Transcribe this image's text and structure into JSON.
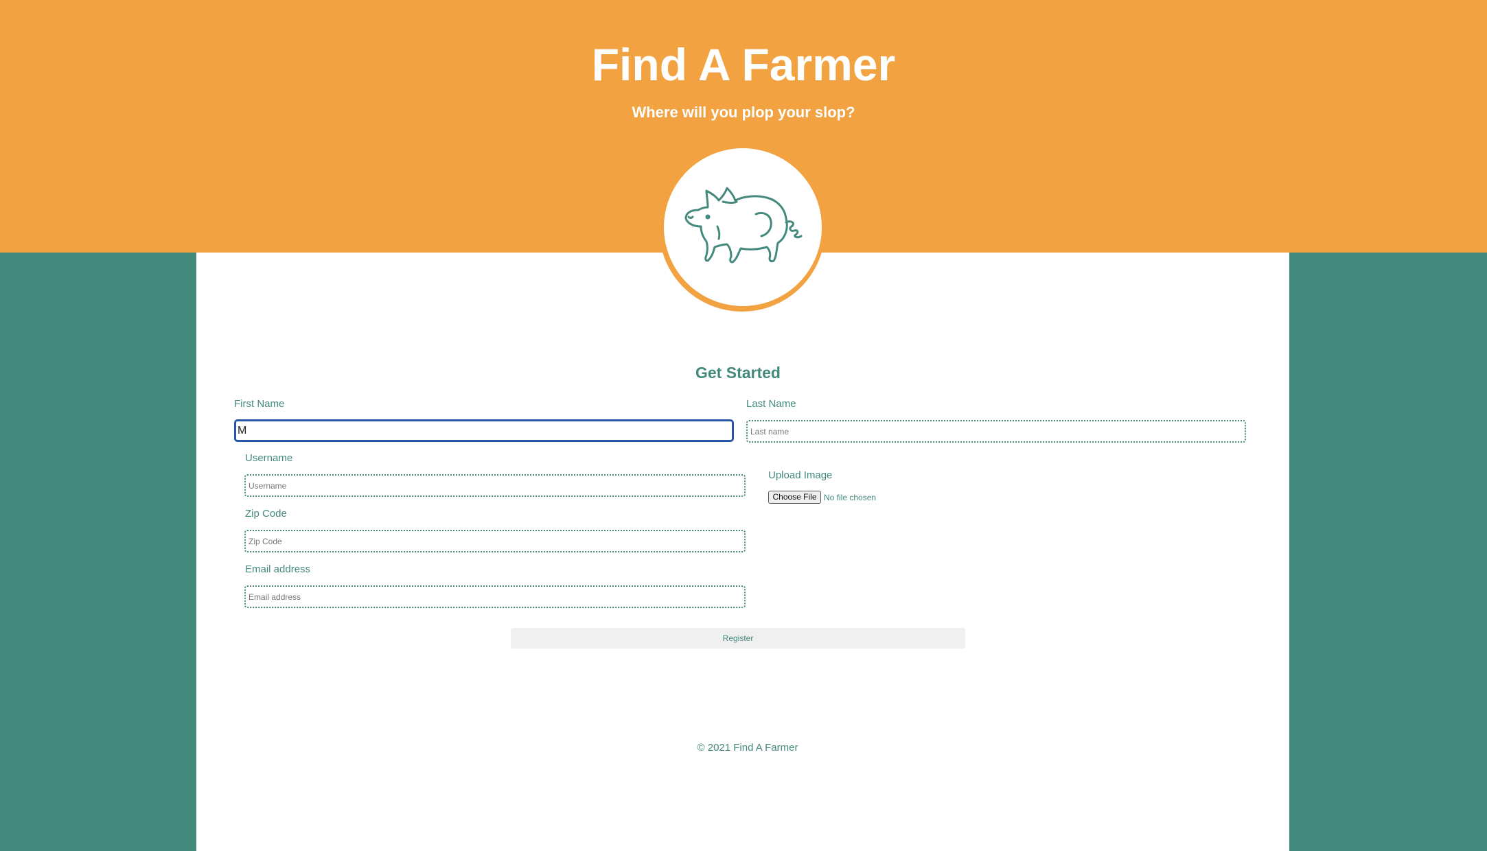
{
  "header": {
    "title": "Find A Farmer",
    "tagline": "Where will you plop your slop?",
    "logo_icon": "pig-icon"
  },
  "form": {
    "title": "Get Started",
    "first_name": {
      "label": "First Name",
      "value": "M",
      "placeholder": ""
    },
    "last_name": {
      "label": "Last Name",
      "value": "",
      "placeholder": "Last name"
    },
    "username": {
      "label": "Username",
      "value": "",
      "placeholder": "Username"
    },
    "zip_code": {
      "label": "Zip Code",
      "value": "",
      "placeholder": "Zip Code"
    },
    "email": {
      "label": "Email address",
      "value": "",
      "placeholder": "Email address"
    },
    "upload": {
      "label": "Upload Image",
      "button_label": "Choose File",
      "status": "No file chosen"
    },
    "register_label": "Register"
  },
  "footer": {
    "copyright": "© 2021 Find A Farmer"
  },
  "colors": {
    "header_orange": "#f2a241",
    "teal": "#43897c",
    "focus_blue": "#2756a9"
  }
}
